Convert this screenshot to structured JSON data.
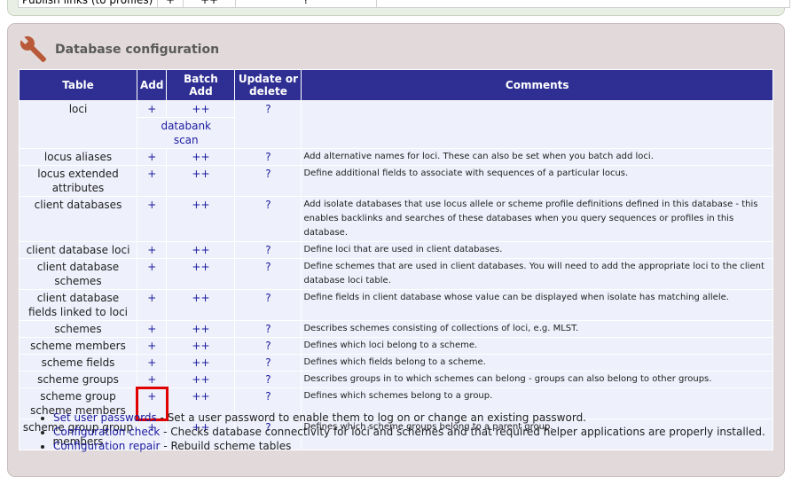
{
  "top_partial": {
    "cells": [
      "Publish links (to profiles)",
      "+",
      "++",
      "?"
    ]
  },
  "panel": {
    "title": "Database configuration",
    "icon": "wrench-icon"
  },
  "table": {
    "headers": {
      "table": "Table",
      "add": "Add",
      "batch_line1": "Batch",
      "batch_line2": "Add",
      "update_line1": "Update or",
      "update_line2": "delete",
      "comments": "Comments"
    },
    "extra_links": {
      "databank": "databank",
      "scan": "scan"
    },
    "rows": [
      {
        "name": "loci",
        "add": "+",
        "batch": "++",
        "update": "?",
        "comment": ""
      },
      {
        "name": "locus aliases",
        "add": "+",
        "batch": "++",
        "update": "?",
        "comment": "Add alternative names for loci. These can also be set when you batch add loci."
      },
      {
        "name": "locus extended attributes",
        "add": "+",
        "batch": "++",
        "update": "?",
        "comment": "Define additional fields to associate with sequences of a particular locus."
      },
      {
        "name": "client databases",
        "add": "+",
        "batch": "++",
        "update": "?",
        "comment": "Add isolate databases that use locus allele or scheme profile definitions defined in this database - this enables backlinks and searches of these databases when you query sequences or profiles in this database."
      },
      {
        "name": "client database loci",
        "add": "+",
        "batch": "++",
        "update": "?",
        "comment": "Define loci that are used in client databases."
      },
      {
        "name": "client database schemes",
        "add": "+",
        "batch": "++",
        "update": "?",
        "comment": "Define schemes that are used in client databases. You will need to add the appropriate loci to the client database loci table."
      },
      {
        "name": "client database fields linked to loci",
        "add": "+",
        "batch": "++",
        "update": "?",
        "comment": "Define fields in client database whose value can be displayed when isolate has matching allele."
      },
      {
        "name": "schemes",
        "add": "+",
        "batch": "++",
        "update": "?",
        "comment": "Describes schemes consisting of collections of loci, e.g. MLST."
      },
      {
        "name": "scheme members",
        "add": "+",
        "batch": "++",
        "update": "?",
        "comment": "Defines which loci belong to a scheme."
      },
      {
        "name": "scheme fields",
        "add": "+",
        "batch": "++",
        "update": "?",
        "comment": "Defines which fields belong to a scheme."
      },
      {
        "name": "scheme groups",
        "add": "+",
        "batch": "++",
        "update": "?",
        "comment": "Describes groups in to which schemes can belong - groups can also belong to other groups."
      },
      {
        "name": "scheme group scheme members",
        "add": "+",
        "batch": "++",
        "update": "?",
        "comment": "Defines which schemes belong to a group."
      },
      {
        "name": "scheme group group members",
        "add": "+",
        "batch": "++",
        "update": "?",
        "comment": "Defines which scheme groups belong to a parent group."
      }
    ]
  },
  "links": [
    {
      "label": "Set user passwords",
      "desc": " - Set a user password to enable them to log on or change an existing password."
    },
    {
      "label": "Configuration check",
      "desc": " - Checks database connectivity for loci and schemes and that required helper applications are properly installed."
    },
    {
      "label": "Configuration repair",
      "desc": " - Rebuild scheme tables"
    }
  ],
  "colors": {
    "header_bg": "#2f2f93",
    "panel_bg": "#e2dada",
    "link": "#1b1b9e",
    "highlight": "#e00000"
  }
}
